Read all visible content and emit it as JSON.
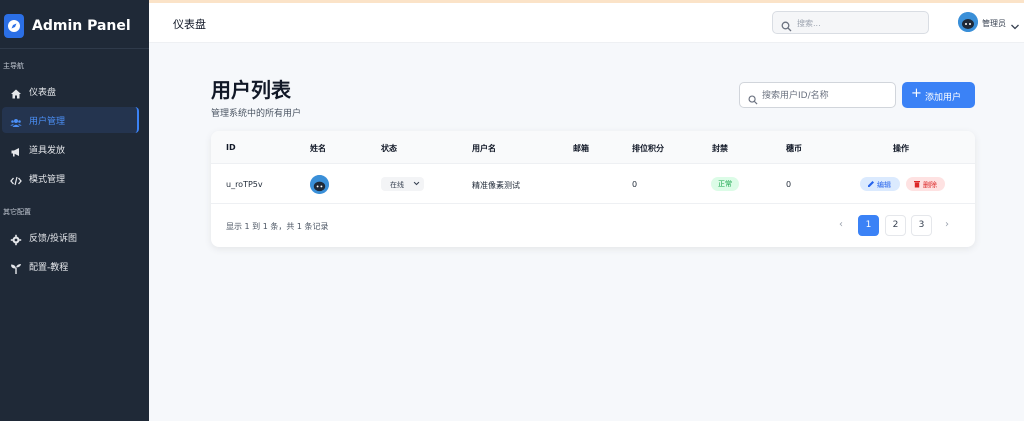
{
  "sidebar": {
    "brand": "Admin Panel",
    "sections": [
      {
        "label": "主导航"
      },
      {
        "label": "其它配置"
      }
    ],
    "items": [
      {
        "label": "仪表盘",
        "icon": "home-icon"
      },
      {
        "label": "用户管理",
        "icon": "users-icon",
        "active": true
      },
      {
        "label": "道具发放",
        "icon": "megaphone-icon"
      },
      {
        "label": "模式管理",
        "icon": "code-icon"
      },
      {
        "label": "反馈/投诉图",
        "icon": "gear-icon"
      },
      {
        "label": "配置-教程",
        "icon": "sprout-icon"
      }
    ]
  },
  "header": {
    "title": "仪表盘",
    "search_placeholder": "搜索...",
    "user_name": "管理员"
  },
  "page": {
    "title": "用户列表",
    "subtitle": "管理系统中的所有用户",
    "search_placeholder": "搜索用户ID/名称",
    "add_button": "添加用户"
  },
  "table": {
    "columns": [
      "ID",
      "姓名",
      "状态",
      "用户名",
      "邮箱",
      "排位积分",
      "封禁",
      "穗币",
      "操作"
    ],
    "rows": [
      {
        "id": "u_roTP5v",
        "status": "在线",
        "username": "精准像素测试",
        "email": "",
        "rank_points": "0",
        "ban": "正常",
        "coins": "0",
        "edit": "编辑",
        "delete": "删除"
      }
    ],
    "summary": "显示 1 到 1 条，共 1 条记录",
    "pages": [
      "1",
      "2",
      "3"
    ],
    "current_page": "1"
  },
  "colors": {
    "sidebar_bg": "#1f2937",
    "accent": "#3b82f6",
    "success": "#16a34a",
    "danger": "#dc2626"
  }
}
